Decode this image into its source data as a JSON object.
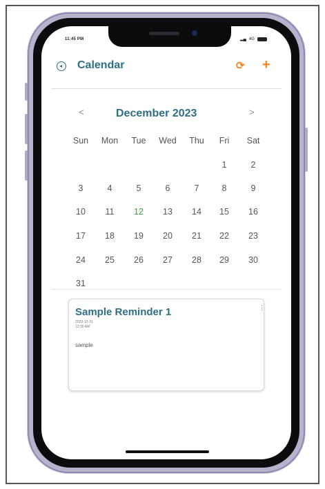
{
  "status_bar": {
    "time": "11:45 PM",
    "signal": "4G"
  },
  "header": {
    "title": "Calendar",
    "sync_icon": "sync-icon",
    "add_icon": "plus-icon",
    "back_icon": "back-circle-icon",
    "accent_color": "#f0861c",
    "title_color": "#2f6f86"
  },
  "calendar": {
    "month_label": "December 2023",
    "prev": "<",
    "next": ">",
    "weekdays": [
      "Sun",
      "Mon",
      "Tue",
      "Wed",
      "Thu",
      "Fri",
      "Sat"
    ],
    "first_weekday_index": 5,
    "days_in_month": 31,
    "today": 12,
    "today_color": "#3f9a4a"
  },
  "reminder": {
    "title": "Sample Reminder 1",
    "date": "2023-12-31",
    "time": "12:00 AM",
    "body": "sample",
    "menu": "⋮"
  }
}
